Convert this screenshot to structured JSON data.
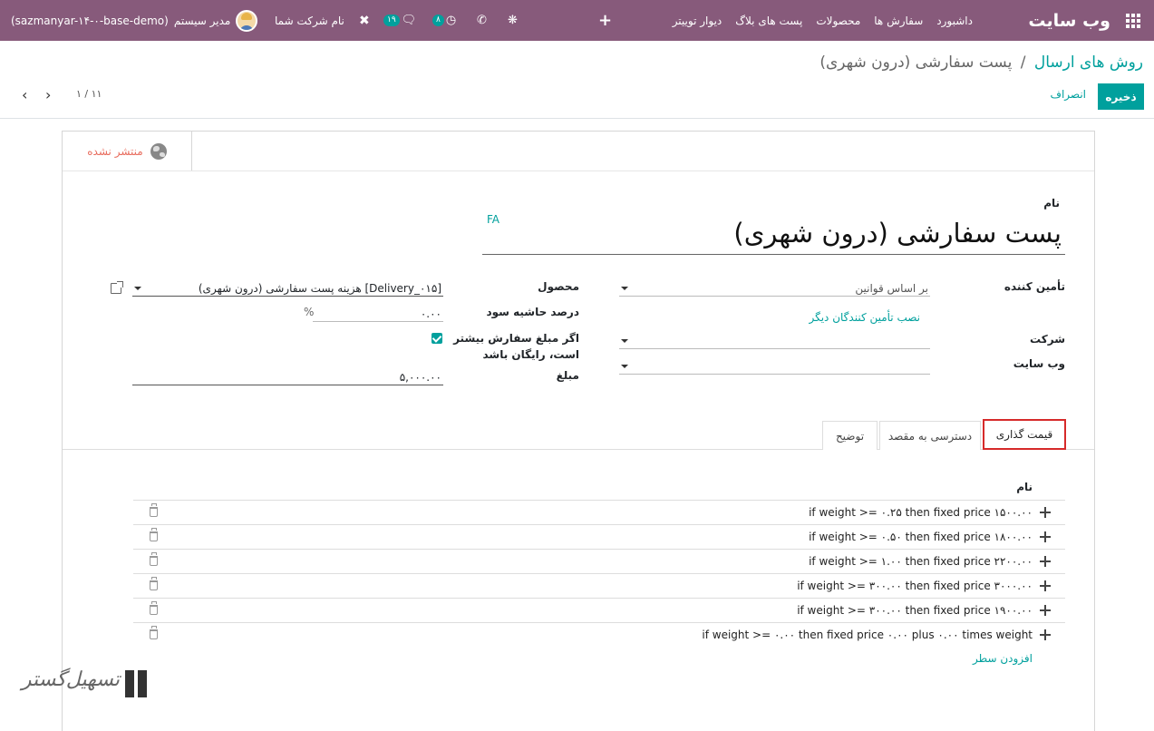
{
  "topbar": {
    "brand": "وب سایت",
    "menu": [
      "داشبورد",
      "سفارش ها",
      "محصولات",
      "پست های بلاگ",
      "دیوار توییتر"
    ],
    "plus": "+",
    "company": "نام شرکت شما",
    "user": "مدیر سیستم",
    "database": "(sazmanyar-۱۴-۰-base-demo)",
    "messages_count": "۱۹",
    "activities_count": "۸"
  },
  "breadcrumb": {
    "parent": "روش های ارسال",
    "separator": "/",
    "current": "پست سفارشی (درون شهری)"
  },
  "buttons": {
    "save": "ذخیره",
    "discard": "انصراف"
  },
  "pager": {
    "value": "۱ / ۱۱"
  },
  "sheet": {
    "publish_status": "منتشر نشده",
    "name_label": "نام",
    "lang_badge": "FA",
    "name_value": "پست سفارشی (درون شهری)",
    "provider_label": "تأمین کننده",
    "provider_value": "بر اساس قوانین",
    "install_more": "نصب تأمین کنندگان دیگر",
    "company_label": "شرکت",
    "company_value": "",
    "website_label": "وب سایت",
    "website_value": "",
    "product_label": "محصول",
    "product_value": "[Delivery_۰۱۵] هزینه پست سفارشی (درون شهری)",
    "margin_label": "درصد حاشیه سود",
    "margin_value": "۰.۰۰",
    "margin_unit": "%",
    "free_label": "اگر مبلغ سفارش بیشتر است، رایگان باشد",
    "free_checked": true,
    "amount_label": "مبلغ",
    "amount_value": "۵,۰۰۰.۰۰"
  },
  "tabs": [
    {
      "label": "قیمت گذاری",
      "active": true
    },
    {
      "label": "دسترسی به مقصد",
      "active": false
    },
    {
      "label": "توضیح",
      "active": false
    }
  ],
  "table": {
    "header": "نام",
    "rows": [
      "if weight >= ۰.۲۵ then fixed price ۱۵۰۰.۰۰",
      "if weight >= ۰.۵۰ then fixed price ۱۸۰۰.۰۰",
      "if weight >= ۱.۰۰ then fixed price ۲۲۰۰.۰۰",
      "if weight >= ۳۰۰.۰۰ then fixed price ۳۰۰۰.۰۰",
      "if weight >= ۳۰۰.۰۰ then fixed price ۱۹۰۰.۰۰",
      "if weight >= ۰.۰۰ then fixed price ۰.۰۰ plus ۰.۰۰ times weight"
    ],
    "add_line": "افزودن سطر"
  },
  "watermark": "تسهیل‌گستر",
  "colors": {
    "navbar": "#875a7b",
    "accent": "#00a09d",
    "unpublished": "#e86c5d",
    "tab_highlight": "#d62a2a"
  }
}
